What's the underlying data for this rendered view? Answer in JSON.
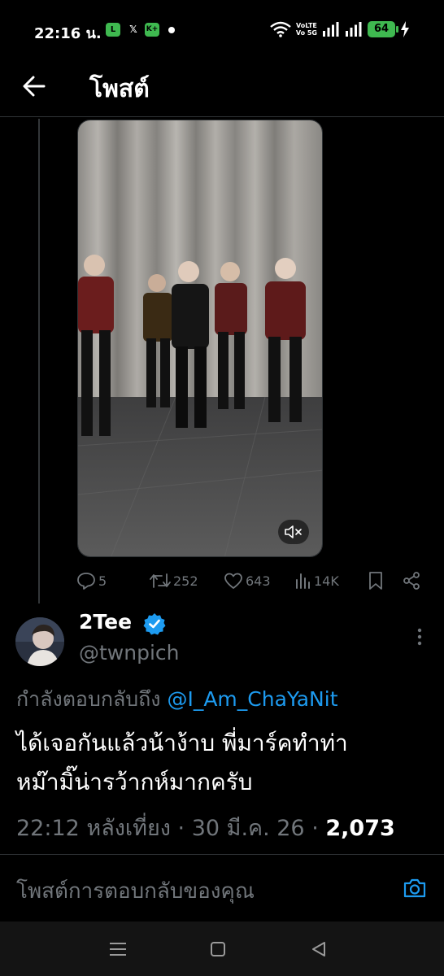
{
  "status_bar": {
    "time": "22:16 น.",
    "apps": {
      "line": "💬",
      "x": "𝕏",
      "k": "K+"
    },
    "volte_top": "VoLTE",
    "volte_bottom": "Vo 5G",
    "battery": "64"
  },
  "header": {
    "title": "โพสต์"
  },
  "video": {
    "muted": true
  },
  "actions": {
    "replies": "5",
    "reposts": "252",
    "likes": "643",
    "views": "14K"
  },
  "reply": {
    "display_name": "2Tee",
    "verified": true,
    "handle": "@twnpich",
    "replying_label": "กำลังตอบกลับถึง",
    "replying_to": "@I_Am_ChaYaNit",
    "text_line1": "ได้เจอกันแล้วน้าง้าบ พี่มาร์คทำท่า",
    "text_line2": "หม๊ามิ๊น่ารว้ากห์มากครับ",
    "time": "22:12 หลังเที่ยง",
    "date": "30 มี.ค. 26",
    "separator": " · ",
    "view_count": "2,073"
  },
  "composer": {
    "placeholder": "โพสต์การตอบกลับของคุณ"
  },
  "icons": [
    "back-arrow-icon",
    "mute-icon",
    "reply-icon",
    "repost-icon",
    "like-icon",
    "views-icon",
    "bookmark-icon",
    "share-icon",
    "verified-icon",
    "more-icon",
    "camera-icon",
    "menu-icon",
    "home-icon",
    "back-icon"
  ],
  "colors": {
    "background": "#000000",
    "accent": "#1d9bf0",
    "muted": "#71767b",
    "battery": "#3fb950"
  }
}
